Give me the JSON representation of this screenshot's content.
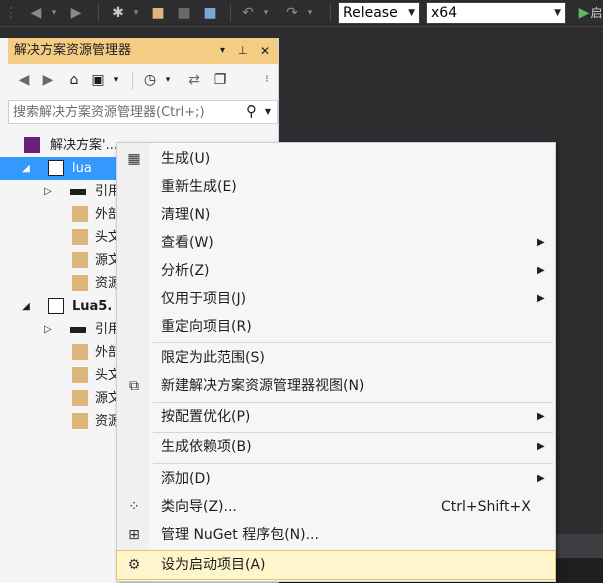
{
  "toolbar": {
    "config_value": "Release",
    "platform_value": "x64",
    "start_label": "启",
    "icons": [
      "drag-handle-icon",
      "back-icon",
      "dropdown-arrow-icon",
      "forward-icon",
      "new-item-icon",
      "open-folder-icon",
      "save-icon",
      "save-all-icon",
      "undo-icon",
      "redo-icon",
      "start-icon"
    ]
  },
  "pane": {
    "title": "解决方案资源管理器",
    "title_buttons": {
      "dropdown": "▾",
      "pin": "📌",
      "close": "✕"
    },
    "search_placeholder": "搜索解决方案资源管理器(Ctrl+;)"
  },
  "tree": [
    {
      "label": "解决方案'...",
      "indent": 0,
      "icon": "solution-icon",
      "expander": ""
    },
    {
      "label": "lua",
      "indent": 1,
      "icon": "project-icon",
      "expander": "◢",
      "selected": true
    },
    {
      "label": "引用",
      "indent": 2,
      "icon": "references-icon",
      "expander": "▷"
    },
    {
      "label": "外部",
      "indent": 2,
      "icon": "folder-icon",
      "expander": ""
    },
    {
      "label": "头文",
      "indent": 2,
      "icon": "folder-icon",
      "expander": ""
    },
    {
      "label": "源文",
      "indent": 2,
      "icon": "folder-icon",
      "expander": ""
    },
    {
      "label": "资源",
      "indent": 2,
      "icon": "folder-icon",
      "expander": ""
    },
    {
      "label": "Lua5.",
      "indent": 1,
      "icon": "project-icon",
      "expander": "◢"
    },
    {
      "label": "引用",
      "indent": 2,
      "icon": "references-icon",
      "expander": "▷"
    },
    {
      "label": "外部",
      "indent": 2,
      "icon": "folder-icon",
      "expander": ""
    },
    {
      "label": "头文",
      "indent": 2,
      "icon": "folder-icon",
      "expander": ""
    },
    {
      "label": "源文",
      "indent": 2,
      "icon": "folder-icon",
      "expander": ""
    },
    {
      "label": "资源",
      "indent": 2,
      "icon": "folder-icon",
      "expander": ""
    }
  ],
  "menu": {
    "items": [
      {
        "label": "生成(U)",
        "icon": "build-icon",
        "submenu": false
      },
      {
        "label": "重新生成(E)",
        "submenu": false
      },
      {
        "label": "清理(N)",
        "submenu": false
      },
      {
        "label": "查看(W)",
        "submenu": true
      },
      {
        "label": "分析(Z)",
        "submenu": true
      },
      {
        "label": "仅用于项目(J)",
        "submenu": true
      },
      {
        "label": "重定向项目(R)",
        "submenu": false
      },
      {
        "label": "限定为此范围(S)",
        "submenu": false
      },
      {
        "label": "新建解决方案资源管理器视图(N)",
        "icon": "new-view-icon",
        "submenu": false
      },
      {
        "label": "按配置优化(P)",
        "submenu": true
      },
      {
        "label": "生成依赖项(B)",
        "submenu": true
      },
      {
        "label": "添加(D)",
        "submenu": true
      },
      {
        "label": "类向导(Z)...",
        "icon": "class-wizard-icon",
        "shortcut": "Ctrl+Shift+X",
        "submenu": false
      },
      {
        "label": "管理 NuGet 程序包(N)...",
        "icon": "nuget-icon",
        "submenu": false
      },
      {
        "label": "设为启动项目(A)",
        "icon": "gear-icon",
        "submenu": false,
        "highlighted": true
      }
    ],
    "submenu_arrow": "▶"
  }
}
